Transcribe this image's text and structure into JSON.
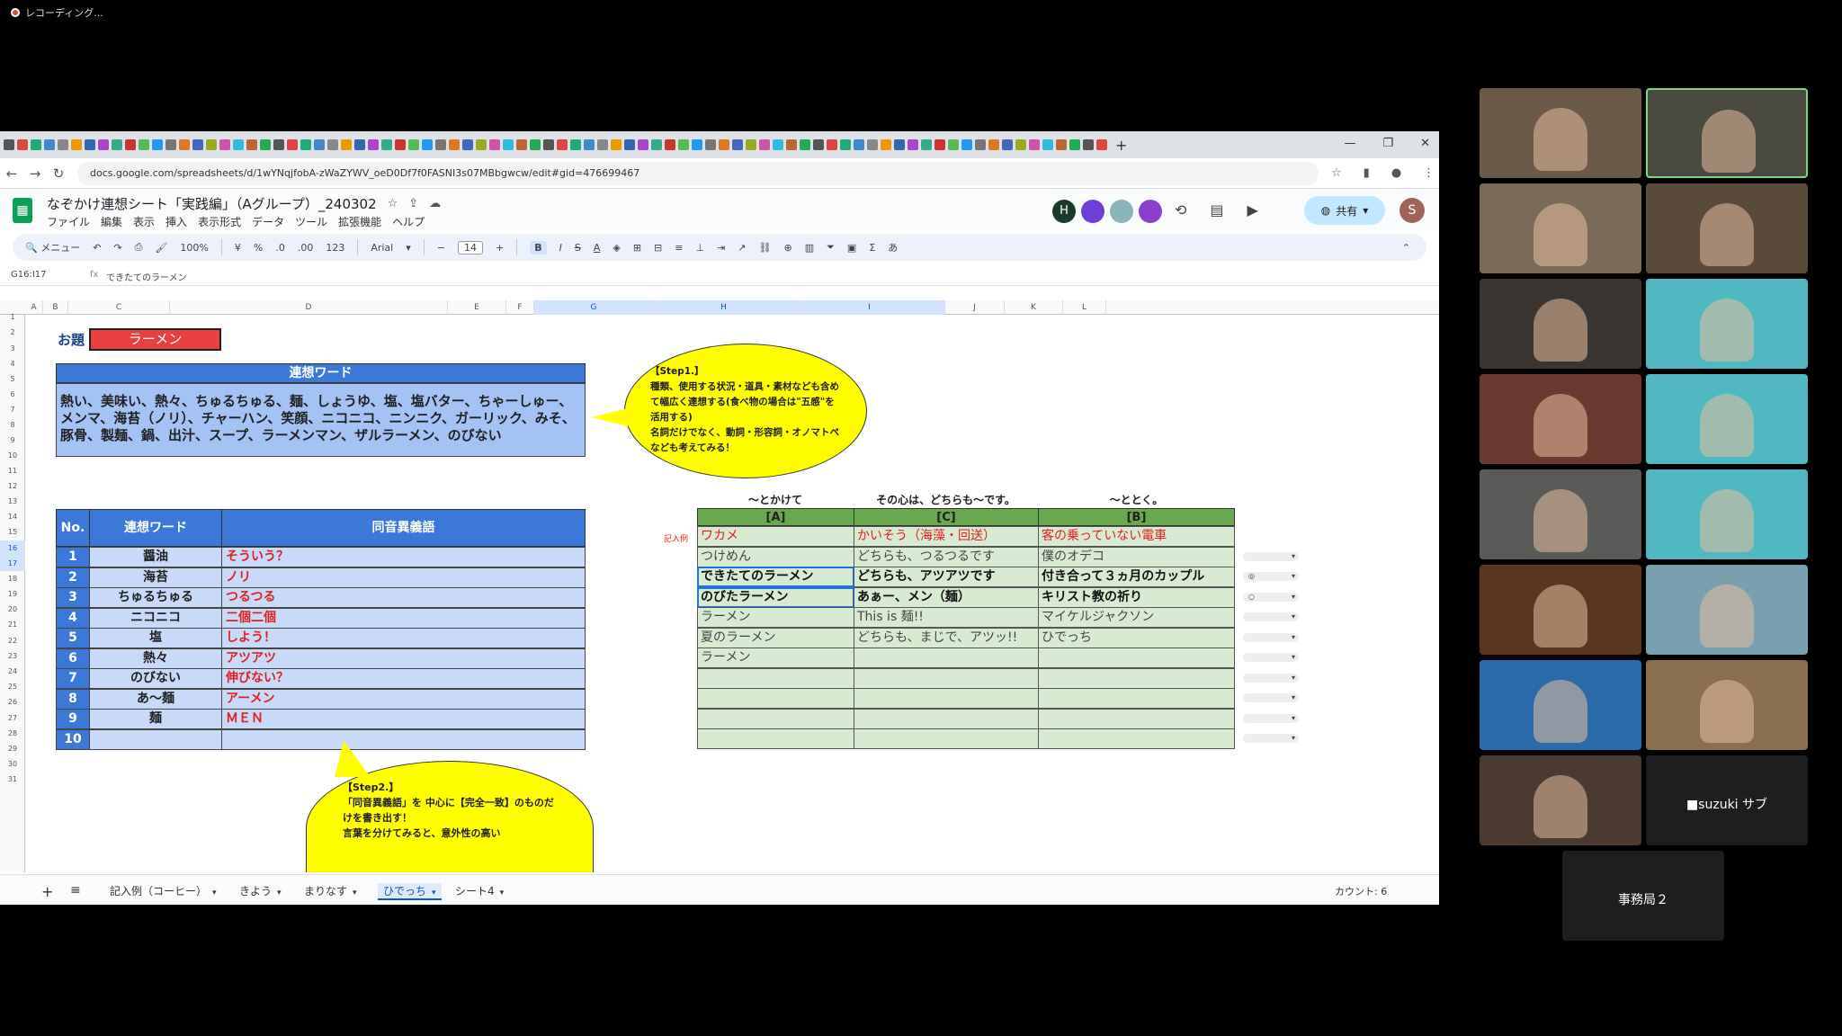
{
  "recording": {
    "label": "レコーディング..."
  },
  "browser": {
    "url": "docs.google.com/spreadsheets/d/1wYNqjfobA-zWaZYWV_oeD0Df7f0FASNI3s07MBbgwcw/edit#gid=476699467"
  },
  "doc": {
    "title": "なぞかけ連想シート「実践編」（Aグループ）_240302",
    "menus": [
      "ファイル",
      "編集",
      "表示",
      "挿入",
      "表示形式",
      "データ",
      "ツール",
      "拡張機能",
      "ヘルプ"
    ],
    "share_label": "共有",
    "user_initial": "S",
    "people": [
      {
        "initial": "H",
        "color": "#1b3a2a"
      },
      {
        "initial": "",
        "color": "#6d3fd8"
      },
      {
        "initial": "",
        "color": "#8ab4b8"
      },
      {
        "initial": "",
        "color": "#8b3fd0"
      }
    ]
  },
  "toolbar": {
    "search": "メニュー",
    "zoom": "100%",
    "currency": "¥",
    "percent": "%",
    "dec_minus": ".0",
    "dec_plus": ".00",
    "format_123": "123",
    "font": "Arial",
    "font_size": "14",
    "bold": "B",
    "italic": "I",
    "strike": "S",
    "textcolor": "A",
    "ime": "あ"
  },
  "formula_bar": {
    "name_box": "G16:I17",
    "fx": "fx",
    "content": "できたてのラーメン"
  },
  "columns": [
    {
      "label": "A",
      "sel": false
    },
    {
      "label": "B",
      "sel": false
    },
    {
      "label": "C",
      "sel": false
    },
    {
      "label": "D",
      "sel": false
    },
    {
      "label": "E",
      "sel": false
    },
    {
      "label": "F",
      "sel": false
    },
    {
      "label": "G",
      "sel": true
    },
    {
      "label": "H",
      "sel": true
    },
    {
      "label": "I",
      "sel": true
    },
    {
      "label": "J",
      "sel": false
    },
    {
      "label": "K",
      "sel": false
    },
    {
      "label": "L",
      "sel": false
    }
  ],
  "rows": [
    "1",
    "2",
    "3",
    "4",
    "5",
    "6",
    "7",
    "8",
    "9",
    "10",
    "11",
    "12",
    "13",
    "14",
    "15",
    "16",
    "17",
    "18",
    "19",
    "20",
    "21",
    "22",
    "23",
    "24",
    "25",
    "26",
    "27",
    "28",
    "29",
    "30",
    "31"
  ],
  "sheet": {
    "odai_label": "お題",
    "odai_value": "ラーメン",
    "rensou_header": "連想ワード",
    "rensou_text": "熱い、美味い、熱々、ちゅるちゅる、麺、しょうゆ、塩、塩バター、ちゃーしゅー、メンマ、海苔（ノリ）、チャーハン、笑顔、ニコニコ、ニンニク、ガーリック、みそ、豚骨、製麺、鍋、出汁、スープ、ラーメンマン、ザルラーメン、のびない",
    "step1": "【Step1.】\n種類、使用する状況・道具・素材なども含めて幅広く連想する(食べ物の場合は\"五感\"を活用する)\n名詞だけでなく、動詞・形容詞・オノマトペなども考えてみる！",
    "step2": "【Step2.】\n「同音異義語」を 中心に【完全一致】のものだけを書き出す！\n言葉を分けてみると、意外性の高い",
    "table_headers": {
      "no": "No.",
      "word": "連想ワード",
      "homonym": "同音異義語"
    },
    "table_rows": [
      {
        "no": "1",
        "word": "醤油",
        "homonym": "そういう？"
      },
      {
        "no": "2",
        "word": "海苔",
        "homonym": "ノリ"
      },
      {
        "no": "3",
        "word": "ちゅるちゅる",
        "homonym": "つるつる"
      },
      {
        "no": "4",
        "word": "ニコニコ",
        "homonym": "二個二個"
      },
      {
        "no": "5",
        "word": "塩",
        "homonym": "しよう！"
      },
      {
        "no": "6",
        "word": "熱々",
        "homonym": "アツアツ"
      },
      {
        "no": "7",
        "word": "のびない",
        "homonym": "伸びない？"
      },
      {
        "no": "8",
        "word": "あ～麺",
        "homonym": "アーメン"
      },
      {
        "no": "9",
        "word": "麺",
        "homonym": "ＭＥＮ"
      },
      {
        "no": "10",
        "word": "",
        "homonym": ""
      }
    ],
    "nazo_top": {
      "a": "～とかけて",
      "c": "その心は、どちらも～です。",
      "b": "～ととく。"
    },
    "nazo_cols": {
      "a": "[A]",
      "c": "[C]",
      "b": "[B]"
    },
    "example_label": "記入例",
    "nazo_rows": [
      {
        "a": "ワカメ",
        "c": "かいそう（海藻・回送）",
        "b": "客の乗っていない電車",
        "style": "ex",
        "dd": ""
      },
      {
        "a": "つけめん",
        "c": "どちらも、つるつるです",
        "b": "僕のオデコ",
        "style": "",
        "dd": ""
      },
      {
        "a": "できたてのラーメン",
        "c": "どちらも、アツアツです",
        "b": "付き合って３ヵ月のカップル",
        "style": "bold",
        "dd": "◎"
      },
      {
        "a": "のびたラーメン",
        "c": "あぁー、メン（麺）",
        "b": "キリスト教の祈り",
        "style": "bold",
        "dd": "○"
      },
      {
        "a": "ラーメン",
        "c": "This is 麺!!",
        "b": "マイケルジャクソン",
        "style": "",
        "dd": ""
      },
      {
        "a": "夏のラーメン",
        "c": "どちらも、まじで、アツッ!!",
        "b": "ひでっち",
        "style": "",
        "dd": ""
      },
      {
        "a": "ラーメン",
        "c": "",
        "b": "",
        "style": "",
        "dd": ""
      },
      {
        "a": "",
        "c": "",
        "b": "",
        "style": "",
        "dd": ""
      },
      {
        "a": "",
        "c": "",
        "b": "",
        "style": "",
        "dd": ""
      },
      {
        "a": "",
        "c": "",
        "b": "",
        "style": "",
        "dd": ""
      },
      {
        "a": "",
        "c": "",
        "b": "",
        "style": "",
        "dd": ""
      }
    ]
  },
  "sheet_tabs": [
    {
      "label": "記入例（コーヒー）",
      "active": false
    },
    {
      "label": "きよう",
      "active": false
    },
    {
      "label": "まりなす",
      "active": false
    },
    {
      "label": "ひでっち",
      "active": true
    },
    {
      "label": "シート4",
      "active": false
    }
  ],
  "status": {
    "count": "カウント: 6"
  },
  "video_tiles": [
    {
      "label": "",
      "color": "#6b5a48"
    },
    {
      "label": "",
      "color": "#4a4a40",
      "active": true
    },
    {
      "label": "",
      "color": "#7a6a58"
    },
    {
      "label": "",
      "color": "#5a4a3a"
    },
    {
      "label": "",
      "color": "#3a3530"
    },
    {
      "label": "",
      "color": "#4fb8c0"
    },
    {
      "label": "",
      "color": "#6a3a30"
    },
    {
      "label": "",
      "color": "#4fb8c0"
    },
    {
      "label": "",
      "color": "#5a5a58"
    },
    {
      "label": "",
      "color": "#4fb8c0"
    },
    {
      "label": "",
      "color": "#5a3520"
    },
    {
      "label": "",
      "color": "#7aa0b0"
    },
    {
      "label": "",
      "color": "#2a6aa8"
    },
    {
      "label": "",
      "color": "#8a7050"
    },
    {
      "label": "",
      "color": "#4a3a30"
    },
    {
      "label": "■suzuki サブ",
      "color": "#1e1e1e"
    }
  ],
  "extra_tile": {
    "label": "事務局２",
    "color": "#1e1e1e"
  }
}
